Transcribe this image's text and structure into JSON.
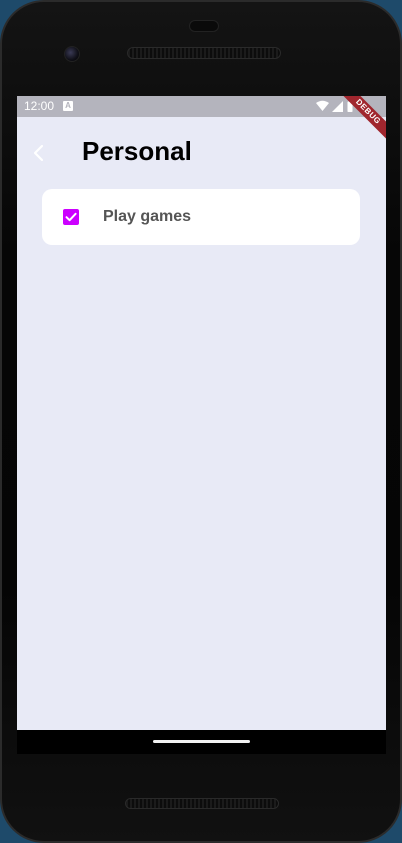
{
  "status_bar": {
    "time": "12:00",
    "notification_icon": "a-icon",
    "wifi_icon": "wifi-icon",
    "signal_icon": "signal-icon",
    "battery_icon": "battery-icon",
    "debug_banner": "DEBUG"
  },
  "app_bar": {
    "back_icon": "chevron-left-icon",
    "title": "Personal"
  },
  "list": {
    "items": [
      {
        "label": "Play games",
        "checked": true
      }
    ]
  },
  "colors": {
    "background": "#e8eaf6",
    "checkbox": "#cc00ff",
    "status_bar": "#b4b4bd",
    "debug_banner": "#a0262e"
  }
}
